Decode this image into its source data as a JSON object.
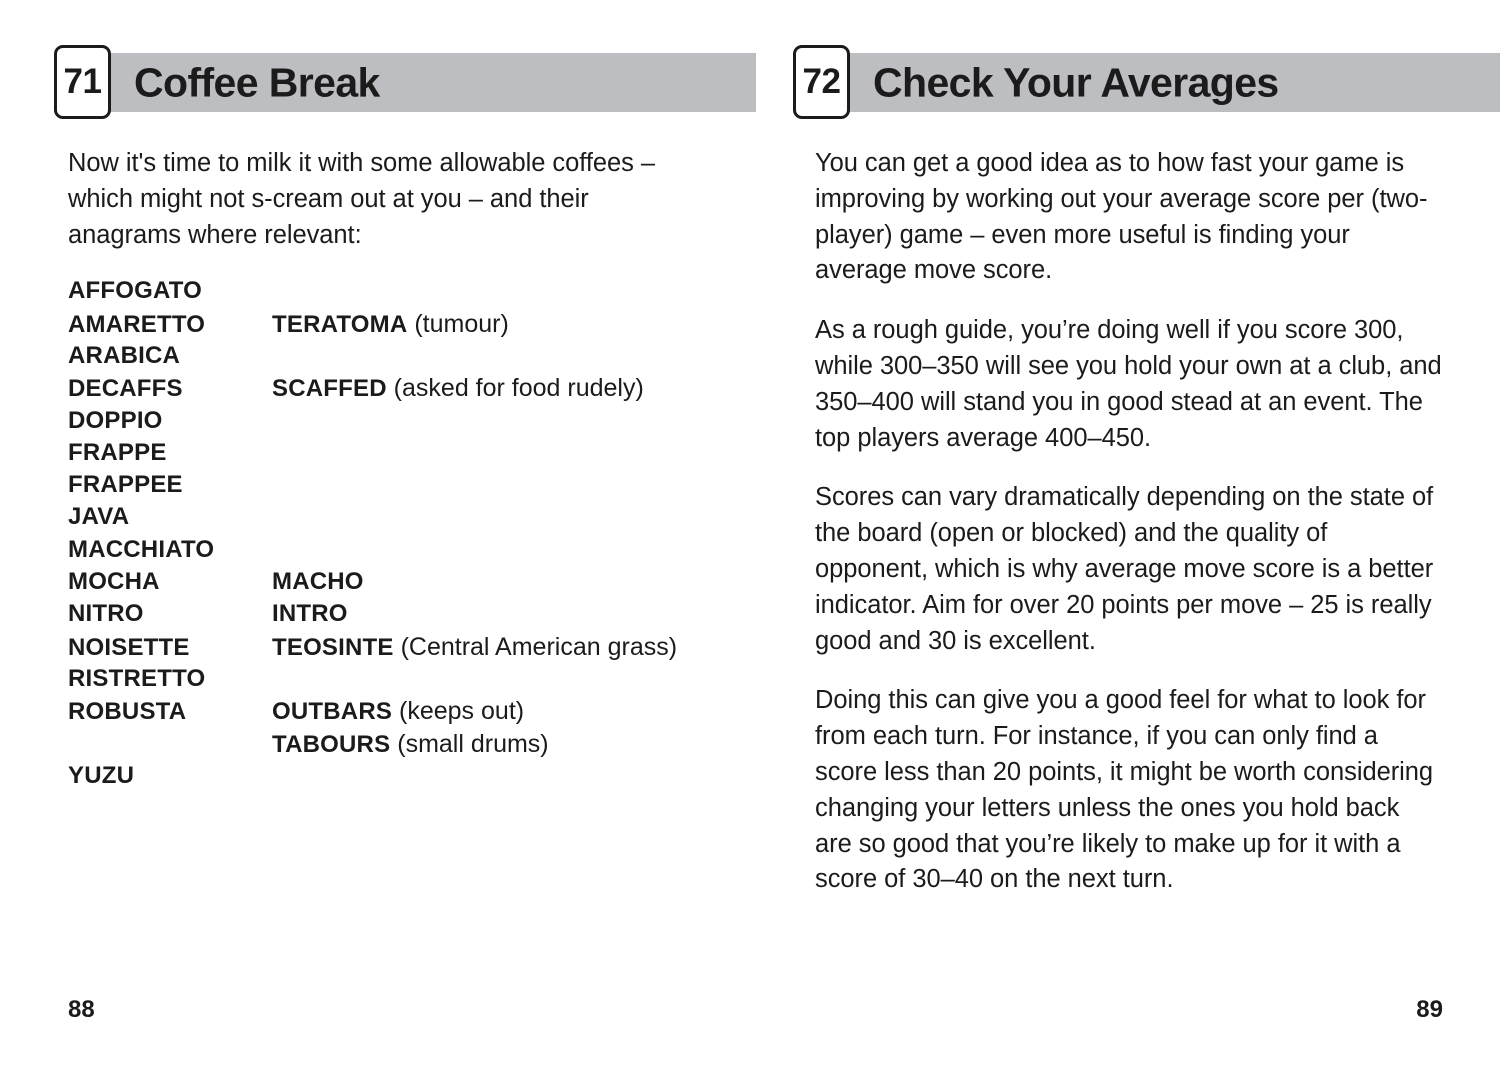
{
  "spread": {
    "left_page": {
      "chapter_number": "71",
      "chapter_title": "Coffee Break",
      "intro": "Now it's time to milk it with some allowable coffees – which might not s-cream out at you – and their anagrams where relevant:",
      "word_list": [
        {
          "term": "AFFOGATO",
          "anagrams": []
        },
        {
          "term": "AMARETTO",
          "anagrams": [
            {
              "word": "TERATOMA",
              "gloss": "(tumour)"
            }
          ]
        },
        {
          "term": "ARABICA",
          "anagrams": []
        },
        {
          "term": "DECAFFS",
          "anagrams": [
            {
              "word": "SCAFFED",
              "gloss": "(asked for food rudely)"
            }
          ]
        },
        {
          "term": "DOPPIO",
          "anagrams": []
        },
        {
          "term": "FRAPPE",
          "anagrams": []
        },
        {
          "term": "FRAPPEE",
          "anagrams": []
        },
        {
          "term": "JAVA",
          "anagrams": []
        },
        {
          "term": "MACCHIATO",
          "anagrams": []
        },
        {
          "term": "MOCHA",
          "anagrams": [
            {
              "word": "MACHO",
              "gloss": ""
            }
          ]
        },
        {
          "term": "NITRO",
          "anagrams": [
            {
              "word": "INTRO",
              "gloss": ""
            }
          ]
        },
        {
          "term": "NOISETTE",
          "anagrams": [
            {
              "word": "TEOSINTE",
              "gloss": "(Central American grass)"
            }
          ]
        },
        {
          "term": "RISTRETTO",
          "anagrams": []
        },
        {
          "term": "ROBUSTA",
          "anagrams": [
            {
              "word": "OUTBARS",
              "gloss": "(keeps out)"
            },
            {
              "word": "TABOURS",
              "gloss": "(small drums)"
            }
          ]
        },
        {
          "term": "YUZU",
          "anagrams": []
        }
      ],
      "folio": "88"
    },
    "right_page": {
      "chapter_number": "72",
      "chapter_title": "Check Your Averages",
      "paragraphs": [
        "You can get a good idea as to how fast your game is improving by working out your average score per (two-player) game – even more useful is finding your average move score.",
        "As a rough guide, you’re doing well if you score 300, while 300–350 will see you hold your own at a club, and 350–400 will stand you in good stead at an event. The top players average 400–450.",
        "Scores can vary dramatically depending on the state of the board (open or blocked) and the quality of opponent, which is why average move score is a better indicator. Aim for over 20 points per move – 25 is really good and 30 is excellent.",
        "Doing this can give you a good feel for what to look for from each turn. For instance, if you can only find a score less than 20 points, it might be worth considering changing your letters unless the ones you hold back are so good that you’re likely to make up for it with a score of 30–40 on the next turn."
      ],
      "folio": "89"
    }
  },
  "colors": {
    "header_bar": "#bdbec2",
    "text": "#1b1b1b",
    "page_background": "#ffffff"
  }
}
